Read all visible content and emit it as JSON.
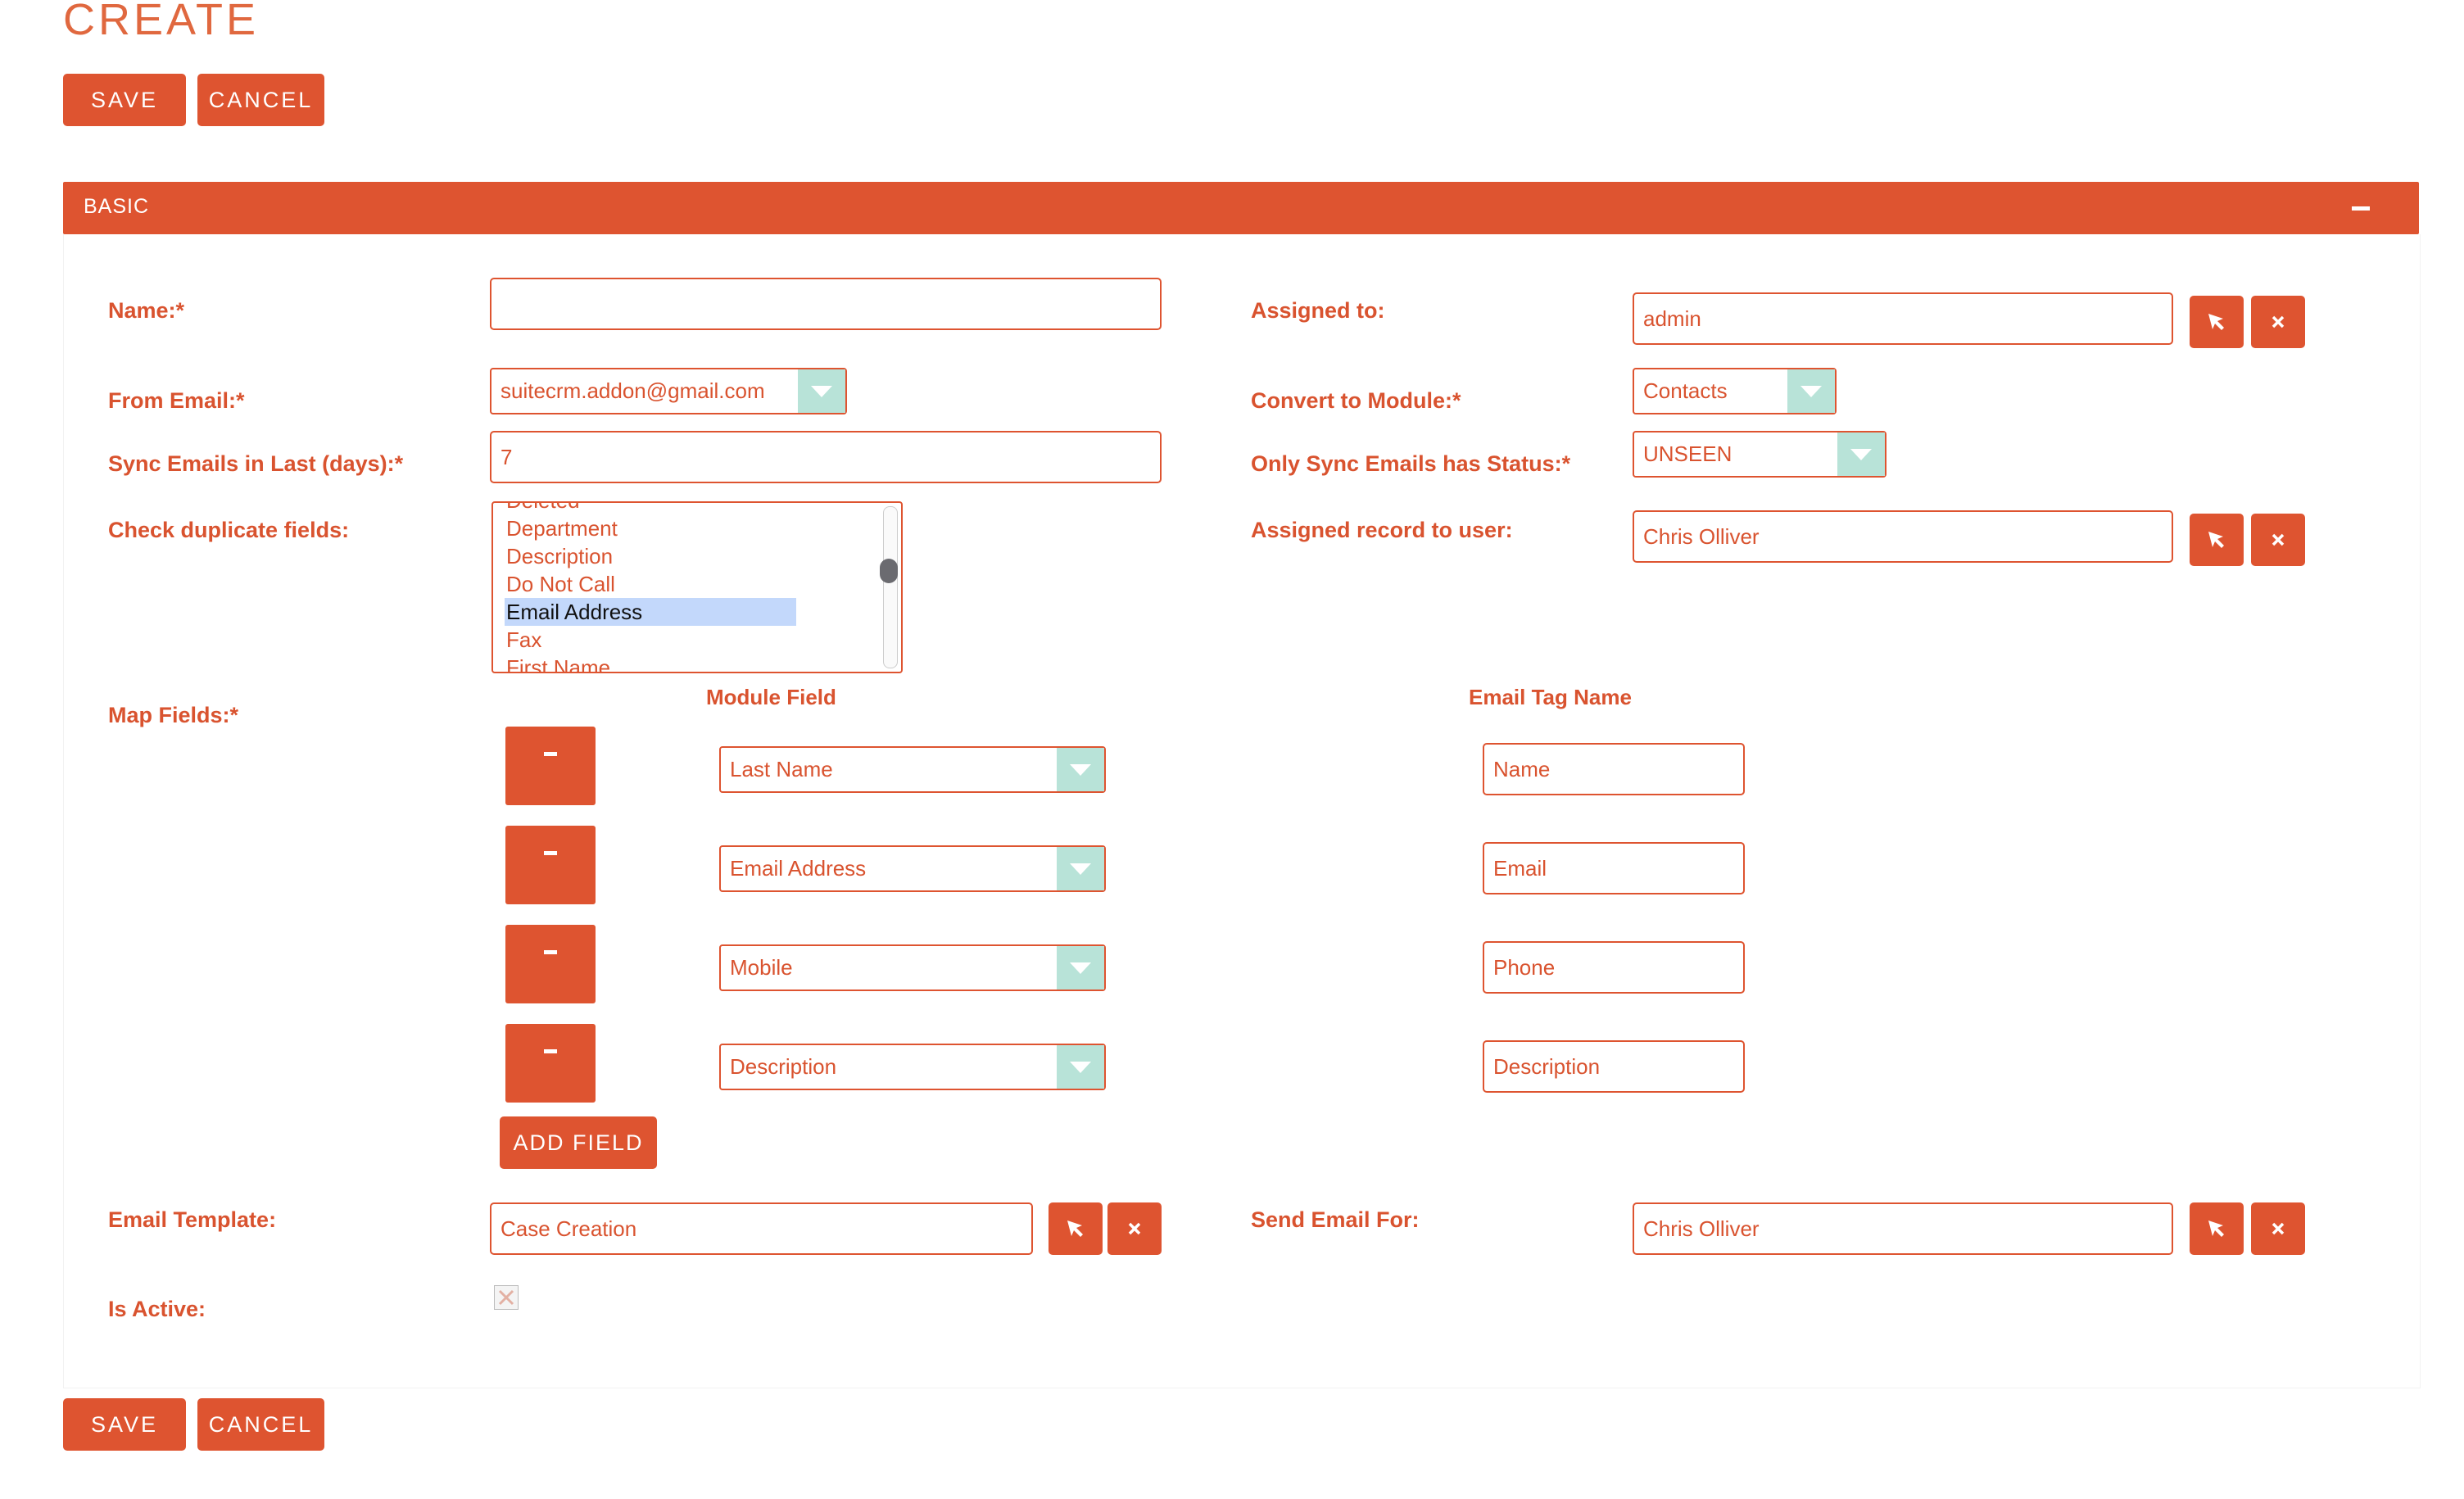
{
  "page": {
    "title": "CREATE"
  },
  "actions": {
    "save_label": "SAVE",
    "cancel_label": "CANCEL"
  },
  "panel": {
    "title": "BASIC"
  },
  "colors": {
    "accent": "#de5430",
    "select_arrow_bg": "#b8e3d8",
    "selected_option_bg": "#c3d8fb"
  },
  "fields": {
    "name": {
      "label": "Name:*",
      "value": ""
    },
    "from_email": {
      "label": "From Email:*",
      "value": "suitecrm.addon@gmail.com"
    },
    "sync_days": {
      "label": "Sync Emails in Last (days):*",
      "value": "7"
    },
    "check_duplicate": {
      "label": "Check duplicate fields:",
      "options": [
        "Deleted",
        "Department",
        "Description",
        "Do Not Call",
        "Email Address",
        "Fax",
        "First Name"
      ],
      "selected": "Email Address"
    },
    "map_fields": {
      "label": "Map Fields:*"
    },
    "email_template": {
      "label": "Email Template:",
      "value": "Case Creation"
    },
    "is_active": {
      "label": "Is Active:",
      "checked": false
    },
    "assigned_to": {
      "label": "Assigned to:",
      "value": "admin"
    },
    "convert_to_module": {
      "label": "Convert to Module:*",
      "value": "Contacts"
    },
    "only_sync_status": {
      "label": "Only Sync Emails has Status:*",
      "value": "UNSEEN"
    },
    "assigned_record_user": {
      "label": "Assigned record to user:",
      "value": "Chris Olliver"
    },
    "send_email_for": {
      "label": "Send Email For:",
      "value": "Chris Olliver"
    }
  },
  "map": {
    "module_field_header": "Module Field",
    "email_tag_header": "Email Tag Name",
    "rows": [
      {
        "module_field": "Last Name",
        "email_tag": "Name"
      },
      {
        "module_field": "Email Address",
        "email_tag": "Email"
      },
      {
        "module_field": "Mobile",
        "email_tag": "Phone"
      },
      {
        "module_field": "Description",
        "email_tag": "Description"
      }
    ],
    "add_field_label": "ADD FIELD"
  },
  "icons": {
    "select": "cursor-arrow-icon",
    "clear": "close-x-icon",
    "remove_row": "minus-icon",
    "collapse": "minus-icon"
  }
}
